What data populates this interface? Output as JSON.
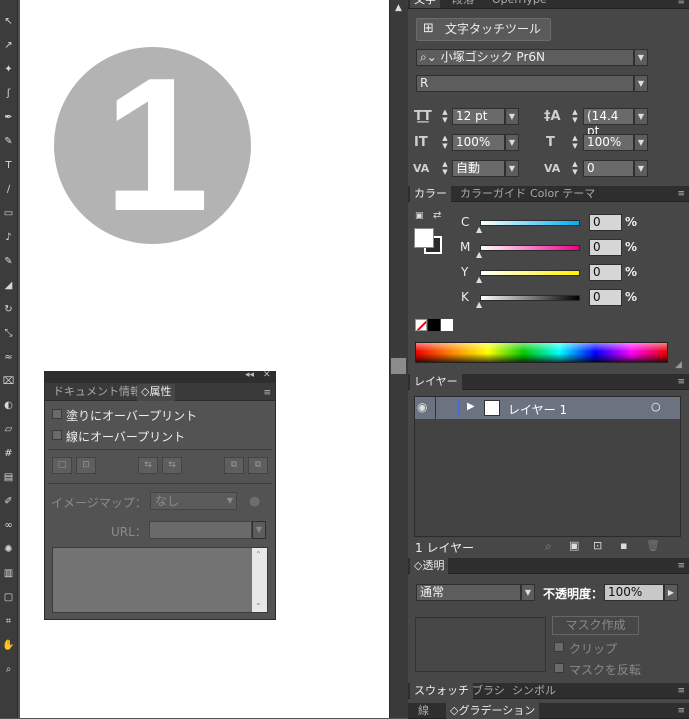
{
  "toolbar": {
    "tools": [
      "selection-tool",
      "direct-selection-tool",
      "magic-wand-tool",
      "lasso-tool",
      "pen-tool",
      "curvature-tool",
      "type-tool",
      "line-tool",
      "rectangle-tool",
      "paintbrush-tool",
      "pencil-tool",
      "eraser-tool",
      "rotate-tool",
      "scale-tool",
      "width-tool",
      "free-transform-tool",
      "shape-builder-tool",
      "perspective-tool",
      "mesh-tool",
      "gradient-tool",
      "eyedropper-tool",
      "blend-tool",
      "symbol-sprayer-tool",
      "graph-tool",
      "artboard-tool",
      "slice-tool",
      "hand-tool",
      "zoom-tool"
    ]
  },
  "canvas": {
    "artwork_text": "1"
  },
  "character_panel": {
    "tabs": [
      "文字",
      "段落",
      "OpenType"
    ],
    "touch_type_button": "文字タッチツール",
    "font_family": "小塚ゴシック Pr6N",
    "font_style": "R",
    "font_size": "12 pt",
    "leading": "(14.4 pt",
    "vertical_scale": "100%",
    "horizontal_scale": "100%",
    "kerning": "自動",
    "tracking": "0"
  },
  "color_panel": {
    "tabs": [
      "カラー",
      "カラーガイド",
      "Color テーマ"
    ],
    "channels": [
      {
        "label": "C",
        "value": "0",
        "unit": "%"
      },
      {
        "label": "M",
        "value": "0",
        "unit": "%"
      },
      {
        "label": "Y",
        "value": "0",
        "unit": "%"
      },
      {
        "label": "K",
        "value": "0",
        "unit": "%"
      }
    ],
    "colors": {
      "cyan": "#00aeef",
      "magenta": "#ec008c",
      "yellow": "#fff200",
      "black": "#000000",
      "fill": "#ffffff"
    }
  },
  "layers_panel": {
    "tab": "レイヤー",
    "layer_name": "レイヤー 1",
    "layer_color": "#4f6bd9",
    "count_label": "1 レイヤー"
  },
  "transparency_panel": {
    "tab": "透明",
    "blend_mode": "通常",
    "opacity_label": "不透明度：",
    "opacity_value": "100%",
    "make_mask_button": "マスク作成",
    "clip_label": "クリップ",
    "invert_mask_label": "マスクを反転"
  },
  "bottom_tabs": {
    "row1": [
      "スウォッチ",
      "ブラシ",
      "シンボル"
    ],
    "row2": [
      "線",
      "グラデーション"
    ]
  },
  "attributes_panel": {
    "tabs": [
      "ドキュメント情報",
      "属性"
    ],
    "overprint_fill": "塗りにオーバープリント",
    "overprint_stroke": "線にオーバープリント",
    "image_map_label": "イメージマップ：",
    "image_map_value": "なし",
    "url_label": "URL："
  }
}
